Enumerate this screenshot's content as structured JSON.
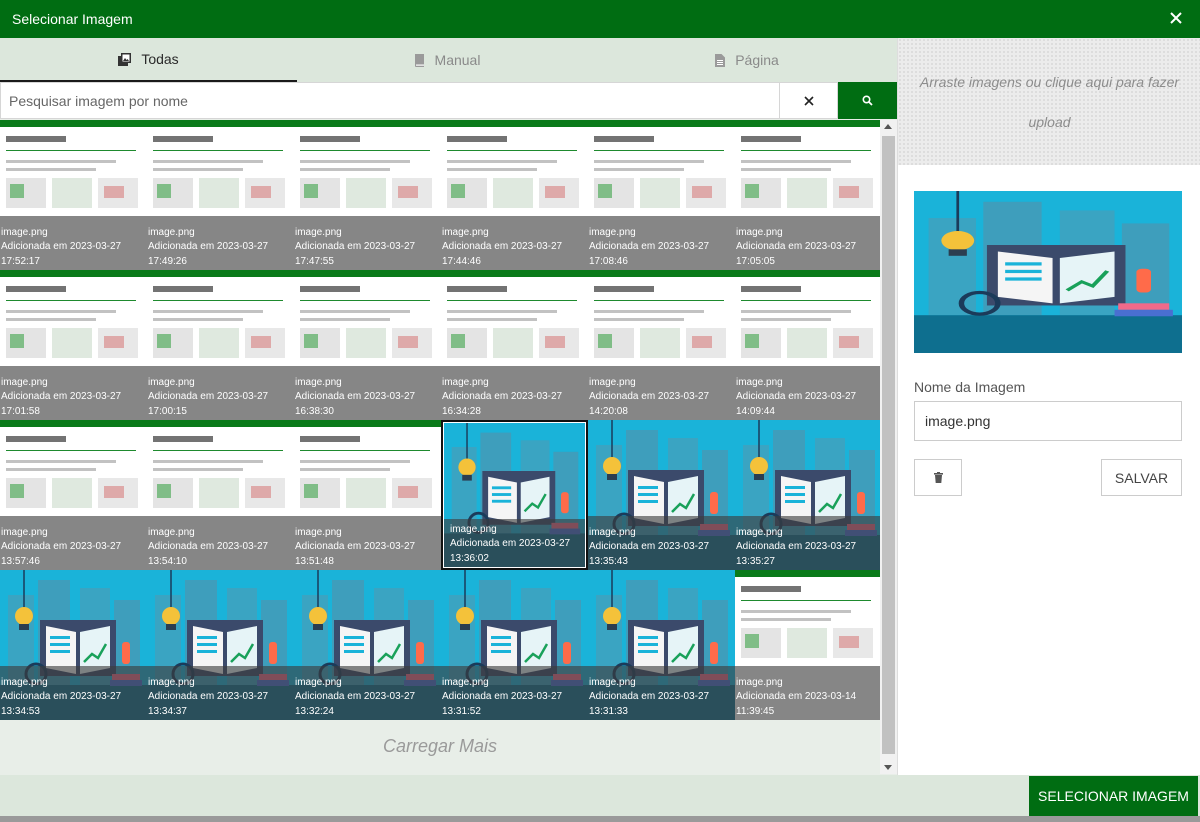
{
  "modal": {
    "title": "Selecionar Imagem",
    "accent_color": "#006d12",
    "icons": {
      "close": "close-icon"
    }
  },
  "tabs": [
    {
      "label": "Todas",
      "icon": "images-icon",
      "active": true
    },
    {
      "label": "Manual",
      "icon": "book-icon",
      "active": false
    },
    {
      "label": "Página",
      "icon": "file-icon",
      "active": false
    }
  ],
  "search": {
    "placeholder": "Pesquisar imagem por nome",
    "value": "",
    "icons": {
      "clear": "close-icon",
      "submit": "search-icon"
    }
  },
  "images": [
    {
      "name": "image.png",
      "date": "Adicionada em 2023-03-27",
      "time": "17:52:17",
      "thumb": "doc"
    },
    {
      "name": "image.png",
      "date": "Adicionada em 2023-03-27",
      "time": "17:49:26",
      "thumb": "doc"
    },
    {
      "name": "image.png",
      "date": "Adicionada em 2023-03-27",
      "time": "17:47:55",
      "thumb": "doc"
    },
    {
      "name": "image.png",
      "date": "Adicionada em 2023-03-27",
      "time": "17:44:46",
      "thumb": "doc"
    },
    {
      "name": "image.png",
      "date": "Adicionada em 2023-03-27",
      "time": "17:08:46",
      "thumb": "doc"
    },
    {
      "name": "image.png",
      "date": "Adicionada em 2023-03-27",
      "time": "17:05:05",
      "thumb": "doc"
    },
    {
      "name": "image.png",
      "date": "Adicionada em 2023-03-27",
      "time": "17:01:58",
      "thumb": "doc"
    },
    {
      "name": "image.png",
      "date": "Adicionada em 2023-03-27",
      "time": "17:00:15",
      "thumb": "doc"
    },
    {
      "name": "image.png",
      "date": "Adicionada em 2023-03-27",
      "time": "16:38:30",
      "thumb": "doc"
    },
    {
      "name": "image.png",
      "date": "Adicionada em 2023-03-27",
      "time": "16:34:28",
      "thumb": "doc"
    },
    {
      "name": "image.png",
      "date": "Adicionada em 2023-03-27",
      "time": "14:20:08",
      "thumb": "doc"
    },
    {
      "name": "image.png",
      "date": "Adicionada em 2023-03-27",
      "time": "14:09:44",
      "thumb": "doc"
    },
    {
      "name": "image.png",
      "date": "Adicionada em 2023-03-27",
      "time": "13:57:46",
      "thumb": "doc"
    },
    {
      "name": "image.png",
      "date": "Adicionada em 2023-03-27",
      "time": "13:54:10",
      "thumb": "doc"
    },
    {
      "name": "image.png",
      "date": "Adicionada em 2023-03-27",
      "time": "13:51:48",
      "thumb": "doc"
    },
    {
      "name": "image.png",
      "date": "Adicionada em 2023-03-27",
      "time": "13:36:02",
      "thumb": "illus",
      "selected": true
    },
    {
      "name": "image.png",
      "date": "Adicionada em 2023-03-27",
      "time": "13:35:43",
      "thumb": "illus"
    },
    {
      "name": "image.png",
      "date": "Adicionada em 2023-03-27",
      "time": "13:35:27",
      "thumb": "illus"
    },
    {
      "name": "image.png",
      "date": "Adicionada em 2023-03-27",
      "time": "13:34:53",
      "thumb": "illus"
    },
    {
      "name": "image.png",
      "date": "Adicionada em 2023-03-27",
      "time": "13:34:37",
      "thumb": "illus"
    },
    {
      "name": "image.png",
      "date": "Adicionada em 2023-03-27",
      "time": "13:32:24",
      "thumb": "illus"
    },
    {
      "name": "image.png",
      "date": "Adicionada em 2023-03-27",
      "time": "13:31:52",
      "thumb": "illus"
    },
    {
      "name": "image.png",
      "date": "Adicionada em 2023-03-27",
      "time": "13:31:33",
      "thumb": "illus"
    },
    {
      "name": "image.png",
      "date": "Adicionada em 2023-03-14",
      "time": "11:39:45",
      "thumb": "doc"
    }
  ],
  "load_more": "Carregar Mais",
  "upload": {
    "text": "Arraste imagens ou clique aqui para fazer upload"
  },
  "details": {
    "name_label": "Nome da Imagem",
    "name_value": "image.png",
    "save_label": "SALVAR",
    "icons": {
      "delete": "trash-icon"
    }
  },
  "footer": {
    "select_label": "SELECIONAR IMAGEM"
  }
}
